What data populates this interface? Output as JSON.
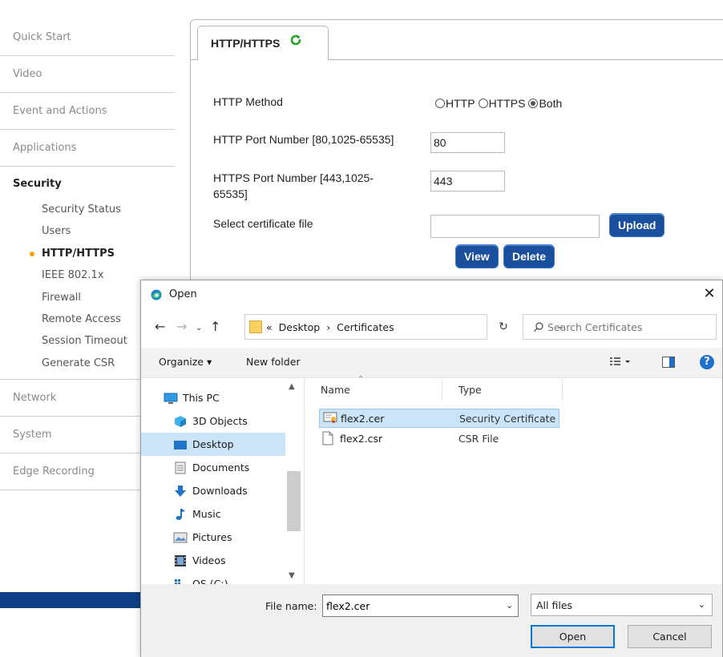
{
  "sidebar": {
    "sections_top": [
      "Quick Start",
      "Video",
      "Event and Actions",
      "Applications"
    ],
    "active_section": "Security",
    "sub_items": [
      "Security Status",
      "Users",
      "HTTP/HTTPS",
      "IEEE 802.1x",
      "Firewall",
      "Remote Access",
      "Session Timeout",
      "Generate CSR"
    ],
    "current_sub_item": "HTTP/HTTPS",
    "sections_bottom": [
      "Network",
      "System",
      "Edge Recording"
    ]
  },
  "panel": {
    "tab_label": "HTTP/HTTPS",
    "http_method_label": "HTTP Method",
    "radio_options": [
      "HTTP",
      "HTTPS",
      "Both"
    ],
    "radio_selected": "Both",
    "http_port_label": "HTTP Port Number [80,1025-65535]",
    "http_port_value": "80",
    "https_port_label_line1": "HTTPS Port Number [443,1025-",
    "https_port_label_line2": "65535]",
    "https_port_value": "443",
    "cert_label": "Select certificate file",
    "cert_value": "",
    "upload_label": "Upload",
    "view_label": "View",
    "delete_label": "Delete"
  },
  "dialog": {
    "title": "Open",
    "close_glyph": "✕",
    "breadcrumb": [
      "«",
      "Desktop",
      "›",
      "Certificates"
    ],
    "search_placeholder": "Search Certificates",
    "organize_label": "Organize ▾",
    "new_folder_label": "New folder",
    "tree": [
      {
        "label": "This PC",
        "icon": "pc-icon"
      },
      {
        "label": "3D Objects",
        "icon": "3d-objects-icon"
      },
      {
        "label": "Desktop",
        "icon": "desktop-icon",
        "selected": true
      },
      {
        "label": "Documents",
        "icon": "documents-icon"
      },
      {
        "label": "Downloads",
        "icon": "downloads-icon"
      },
      {
        "label": "Music",
        "icon": "music-icon"
      },
      {
        "label": "Pictures",
        "icon": "pictures-icon"
      },
      {
        "label": "Videos",
        "icon": "videos-icon"
      },
      {
        "label": "OS (C:)",
        "icon": "drive-icon"
      }
    ],
    "columns": [
      "Name",
      "Type"
    ],
    "files": [
      {
        "name": "flex2.cer",
        "type": "Security Certificate",
        "selected": true
      },
      {
        "name": "flex2.csr",
        "type": "CSR File"
      }
    ],
    "file_name_label": "File name:",
    "file_name_value": "flex2.cer",
    "file_type_value": "All files",
    "open_label": "Open",
    "cancel_label": "Cancel"
  },
  "colors": {
    "accent_blue": "#1a4f9e",
    "nav_dot": "#f0a500",
    "selection": "#cce4f7",
    "bottom_bar": "#0f3f86"
  }
}
